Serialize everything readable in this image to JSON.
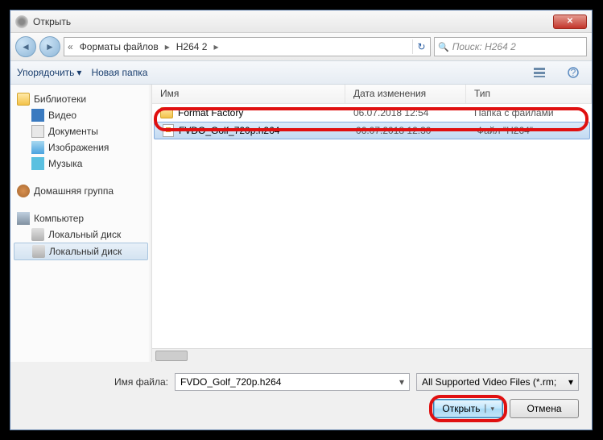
{
  "window": {
    "title": "Открыть"
  },
  "breadcrumb": {
    "part1": "Форматы файлов",
    "part2": "H264 2"
  },
  "search": {
    "placeholder": "Поиск: H264 2"
  },
  "toolbar": {
    "organize": "Упорядочить",
    "new_folder": "Новая папка"
  },
  "sidebar": {
    "libraries": "Библиотеки",
    "video": "Видео",
    "documents": "Документы",
    "images": "Изображения",
    "music": "Музыка",
    "homegroup": "Домашняя группа",
    "computer": "Компьютер",
    "local_disk1": "Локальный диск",
    "local_disk2": "Локальный диск"
  },
  "columns": {
    "name": "Имя",
    "date": "Дата изменения",
    "type": "Тип"
  },
  "files": [
    {
      "name": "Format Factory",
      "date": "06.07.2018 12:54",
      "type": "Папка с файлами",
      "kind": "folder",
      "selected": false
    },
    {
      "name": "FVDO_Golf_720p.h264",
      "date": "06.07.2018 12:30",
      "type": "Файл \"H264\"",
      "kind": "file",
      "selected": true
    }
  ],
  "footer": {
    "filename_label": "Имя файла:",
    "filename_value": "FVDO_Golf_720p.h264",
    "filter": "All Supported Video Files (*.rm;",
    "open": "Открыть",
    "cancel": "Отмена"
  }
}
